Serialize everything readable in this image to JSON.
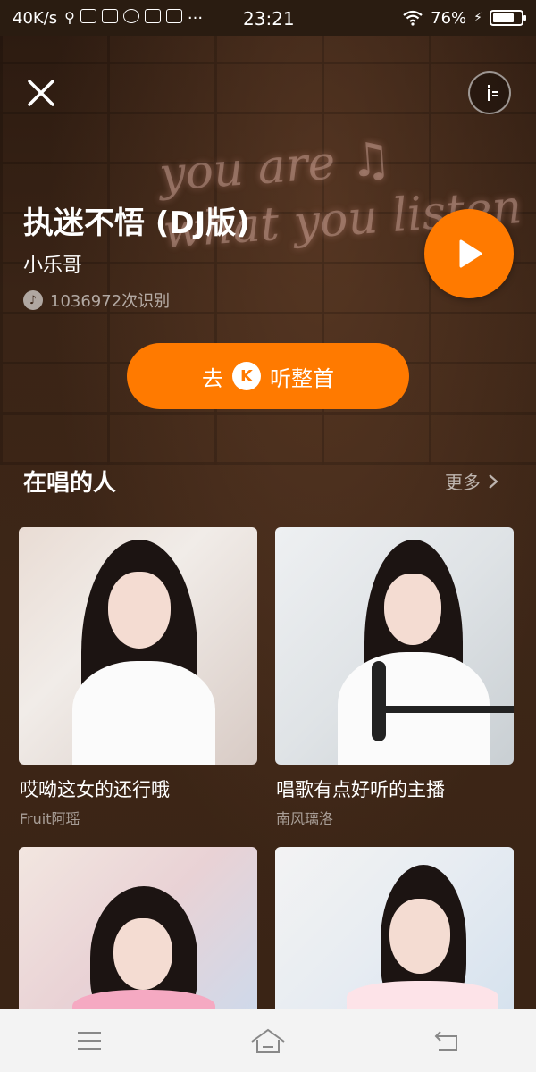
{
  "status_bar": {
    "speed": "40K/s",
    "time": "23:21",
    "battery": "76%",
    "battery_level": 0.76,
    "notification_icons": [
      "usb-icon",
      "vivo-icon",
      "contact-icon",
      "sphere-icon",
      "car-icon",
      "car-icon",
      "more-dots-icon"
    ]
  },
  "song": {
    "title": "执迷不悟 (DJ版)",
    "artist": "小乐哥",
    "recognitions": "1036972次识别"
  },
  "listen_button": {
    "prefix": "去",
    "logo": "K",
    "suffix": "听整首"
  },
  "singers_section": {
    "title": "在唱的人",
    "more_label": "更多"
  },
  "cards": [
    {
      "title": "哎呦这女的还行哦",
      "user": "Fruit阿瑶"
    },
    {
      "title": "唱歌有点好听的主播",
      "user": "南风璃洛"
    },
    {
      "title": "",
      "user": ""
    },
    {
      "title": "",
      "user": ""
    }
  ],
  "colors": {
    "accent": "#ff7a00",
    "background": "#3a2416",
    "nav_bg": "#f3f3f3"
  }
}
